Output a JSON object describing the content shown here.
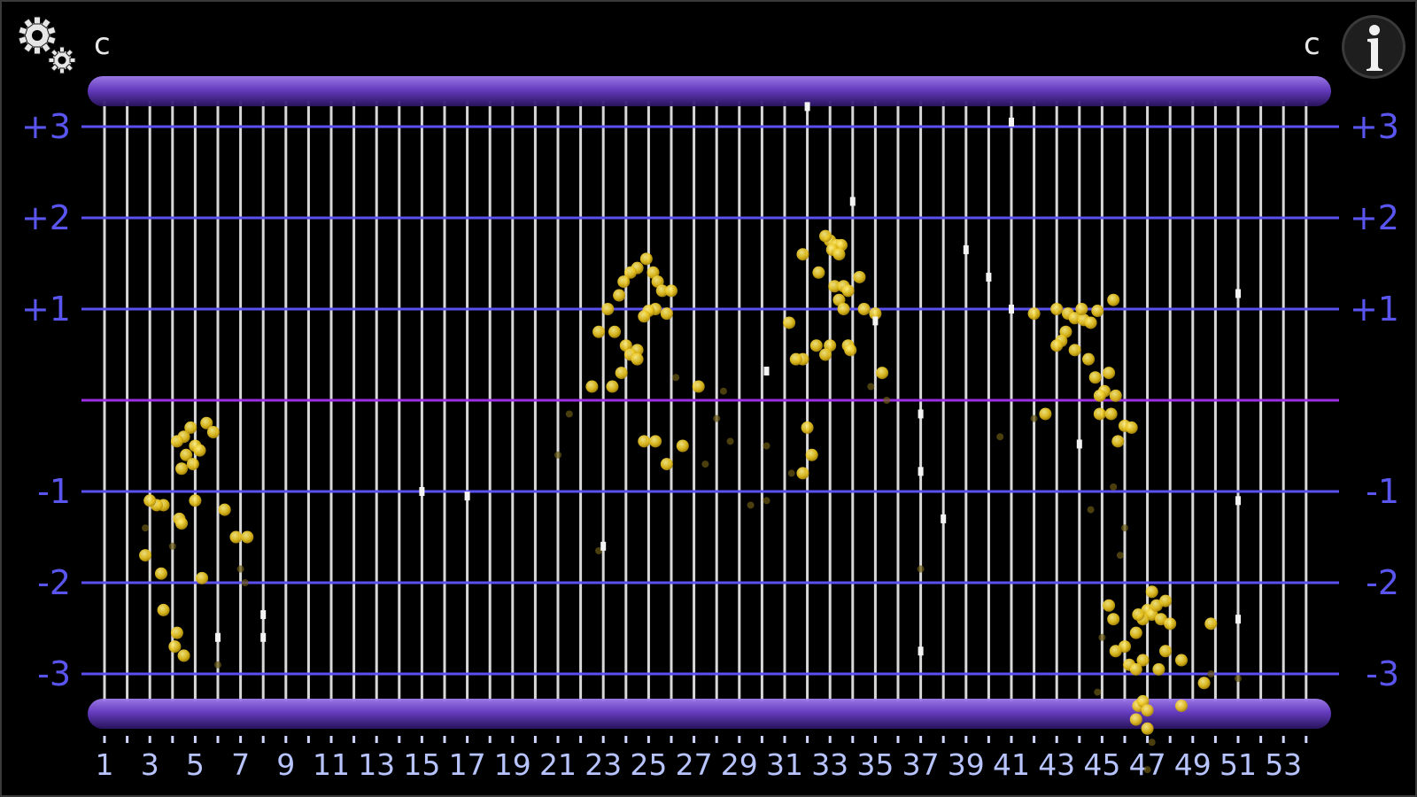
{
  "header": {
    "left_label": "c",
    "right_label": "c",
    "settings_icon": "gears-icon",
    "info_icon": "info-icon"
  },
  "colors": {
    "background": "#000000",
    "grid_vertical": "#d8d8d8",
    "grid_horizontal": "#5b4ff0",
    "baseline": "#9b30e0",
    "label": "#5a55ee",
    "x_label": "#b8c4ff",
    "dot": "#e8c21c",
    "bar": "#7a4fd6"
  },
  "chart_data": {
    "type": "scatter",
    "x_ticks": [
      "1",
      "3",
      "5",
      "7",
      "9",
      "11",
      "13",
      "15",
      "17",
      "19",
      "21",
      "23",
      "25",
      "27",
      "29",
      "31",
      "33",
      "35",
      "37",
      "39",
      "41",
      "43",
      "45",
      "47",
      "49",
      "51",
      "53"
    ],
    "xlim": [
      1,
      54
    ],
    "y_ticks": [
      "+3",
      "+2",
      "+1",
      "-1",
      "-2",
      "-3"
    ],
    "y_tick_values": [
      3,
      2,
      1,
      -1,
      -2,
      -3
    ],
    "ylim": [
      -3,
      3
    ],
    "grid": true,
    "series": [
      {
        "points": [
          [
            4.5,
            -0.4
          ],
          [
            4.8,
            -0.3
          ],
          [
            5.0,
            -0.5
          ],
          [
            4.6,
            -0.6
          ],
          [
            4.9,
            -0.7
          ],
          [
            4.4,
            -0.75
          ],
          [
            5.2,
            -0.55
          ],
          [
            4.2,
            -0.45
          ],
          [
            5.5,
            -0.25
          ],
          [
            5.8,
            -0.35
          ],
          [
            3.6,
            -1.15
          ],
          [
            3.3,
            -1.15
          ],
          [
            4.3,
            -1.3
          ],
          [
            4.4,
            -1.35
          ],
          [
            5.0,
            -1.1
          ],
          [
            6.3,
            -1.2
          ],
          [
            6.8,
            -1.5
          ],
          [
            7.3,
            -1.5
          ],
          [
            3.5,
            -1.9
          ],
          [
            5.3,
            -1.95
          ],
          [
            3.6,
            -2.3
          ],
          [
            4.2,
            -2.55
          ],
          [
            4.1,
            -2.7
          ],
          [
            4.5,
            -2.8
          ],
          [
            2.8,
            -1.7
          ],
          [
            3.0,
            -1.1
          ],
          [
            24.9,
            1.55
          ],
          [
            24.5,
            1.45
          ],
          [
            25.2,
            1.4
          ],
          [
            25.4,
            1.3
          ],
          [
            24.2,
            1.4
          ],
          [
            23.9,
            1.3
          ],
          [
            23.7,
            1.15
          ],
          [
            25.6,
            1.2
          ],
          [
            26.0,
            1.2
          ],
          [
            23.2,
            1.0
          ],
          [
            25.3,
            1.0
          ],
          [
            25.0,
            0.98
          ],
          [
            25.8,
            0.95
          ],
          [
            24.8,
            0.92
          ],
          [
            23.5,
            0.75
          ],
          [
            22.8,
            0.75
          ],
          [
            24.5,
            0.55
          ],
          [
            24.0,
            0.6
          ],
          [
            24.2,
            0.5
          ],
          [
            24.5,
            0.45
          ],
          [
            23.8,
            0.3
          ],
          [
            23.4,
            0.15
          ],
          [
            22.5,
            0.15
          ],
          [
            24.8,
            -0.45
          ],
          [
            25.3,
            -0.45
          ],
          [
            26.5,
            -0.5
          ],
          [
            25.8,
            -0.7
          ],
          [
            27.2,
            0.15
          ],
          [
            33.0,
            1.75
          ],
          [
            33.3,
            1.7
          ],
          [
            33.5,
            1.7
          ],
          [
            33.1,
            1.65
          ],
          [
            33.4,
            1.6
          ],
          [
            32.8,
            1.8
          ],
          [
            31.8,
            1.6
          ],
          [
            32.5,
            1.4
          ],
          [
            33.2,
            1.25
          ],
          [
            33.6,
            1.25
          ],
          [
            33.8,
            1.2
          ],
          [
            33.4,
            1.1
          ],
          [
            33.6,
            1.0
          ],
          [
            34.5,
            1.0
          ],
          [
            35.0,
            0.95
          ],
          [
            31.2,
            0.85
          ],
          [
            33.0,
            0.6
          ],
          [
            33.8,
            0.6
          ],
          [
            33.9,
            0.55
          ],
          [
            31.8,
            0.45
          ],
          [
            31.5,
            0.45
          ],
          [
            32.4,
            0.6
          ],
          [
            32.8,
            0.5
          ],
          [
            34.3,
            1.35
          ],
          [
            35.3,
            0.3
          ],
          [
            32.0,
            -0.3
          ],
          [
            32.2,
            -0.6
          ],
          [
            31.8,
            -0.8
          ],
          [
            43.0,
            1.0
          ],
          [
            43.5,
            0.95
          ],
          [
            43.8,
            0.9
          ],
          [
            44.2,
            0.88
          ],
          [
            44.5,
            0.85
          ],
          [
            44.1,
            1.0
          ],
          [
            43.4,
            0.75
          ],
          [
            43.2,
            0.65
          ],
          [
            43.0,
            0.6
          ],
          [
            44.8,
            0.98
          ],
          [
            45.5,
            1.1
          ],
          [
            42.0,
            0.95
          ],
          [
            44.4,
            0.45
          ],
          [
            44.7,
            0.25
          ],
          [
            45.3,
            0.3
          ],
          [
            45.1,
            0.1
          ],
          [
            44.9,
            0.05
          ],
          [
            44.9,
            -0.15
          ],
          [
            45.4,
            -0.15
          ],
          [
            46.0,
            -0.28
          ],
          [
            46.3,
            -0.3
          ],
          [
            45.7,
            -0.45
          ],
          [
            42.5,
            -0.15
          ],
          [
            43.8,
            0.55
          ],
          [
            45.6,
            0.05
          ],
          [
            47.0,
            -2.3
          ],
          [
            47.2,
            -2.35
          ],
          [
            47.4,
            -2.25
          ],
          [
            46.8,
            -2.4
          ],
          [
            46.6,
            -2.35
          ],
          [
            47.6,
            -2.4
          ],
          [
            47.8,
            -2.2
          ],
          [
            48.0,
            -2.45
          ],
          [
            46.5,
            -2.55
          ],
          [
            47.2,
            -2.1
          ],
          [
            46.0,
            -2.7
          ],
          [
            46.8,
            -2.85
          ],
          [
            47.8,
            -2.75
          ],
          [
            46.2,
            -2.9
          ],
          [
            46.5,
            -2.95
          ],
          [
            47.5,
            -2.95
          ],
          [
            48.5,
            -2.85
          ],
          [
            45.6,
            -2.75
          ],
          [
            46.6,
            -3.35
          ],
          [
            46.8,
            -3.3
          ],
          [
            47.0,
            -3.4
          ],
          [
            46.5,
            -3.5
          ],
          [
            47.0,
            -3.6
          ],
          [
            48.5,
            -3.35
          ],
          [
            49.5,
            -3.1
          ],
          [
            49.8,
            -2.45
          ],
          [
            45.5,
            -2.4
          ],
          [
            45.3,
            -2.25
          ]
        ]
      }
    ],
    "dim_points": [
      [
        4.0,
        -1.6
      ],
      [
        2.8,
        -1.4
      ],
      [
        7.0,
        -1.85
      ],
      [
        6.0,
        -2.9
      ],
      [
        7.2,
        -2.0
      ],
      [
        21.0,
        -0.6
      ],
      [
        21.5,
        -0.15
      ],
      [
        22.8,
        -1.65
      ],
      [
        26.2,
        0.25
      ],
      [
        28.0,
        -0.2
      ],
      [
        28.6,
        -0.45
      ],
      [
        28.3,
        0.1
      ],
      [
        27.5,
        -0.7
      ],
      [
        29.5,
        -1.15
      ],
      [
        30.2,
        -1.1
      ],
      [
        30.2,
        -0.5
      ],
      [
        31.3,
        -0.8
      ],
      [
        34.8,
        0.15
      ],
      [
        35.5,
        0.0
      ],
      [
        37.0,
        -1.85
      ],
      [
        40.5,
        -0.4
      ],
      [
        42.0,
        -0.2
      ],
      [
        44.5,
        -1.2
      ],
      [
        45.5,
        -0.95
      ],
      [
        45.8,
        -1.7
      ],
      [
        45.0,
        -2.6
      ],
      [
        46.0,
        -1.4
      ],
      [
        47.2,
        -3.75
      ],
      [
        47.0,
        -4.05
      ],
      [
        44.8,
        -3.2
      ],
      [
        49.8,
        -3.0
      ],
      [
        51.0,
        -3.05
      ]
    ],
    "white_points": [
      [
        32.0,
        3.22
      ],
      [
        34.0,
        2.18
      ],
      [
        30.2,
        0.32
      ],
      [
        39.0,
        1.65
      ],
      [
        40.0,
        1.35
      ],
      [
        41.0,
        3.05
      ],
      [
        35.0,
        0.87
      ],
      [
        41.0,
        1.0
      ],
      [
        44.0,
        -0.48
      ],
      [
        37.0,
        -0.78
      ],
      [
        51.0,
        1.17
      ],
      [
        51.0,
        -1.1
      ],
      [
        38.0,
        -1.3
      ],
      [
        37.0,
        -2.75
      ],
      [
        51.0,
        -2.4
      ],
      [
        6.0,
        -2.6
      ],
      [
        8.0,
        -2.6
      ],
      [
        15.0,
        -1.0
      ],
      [
        17.0,
        -1.05
      ],
      [
        8.0,
        -2.35
      ],
      [
        23.0,
        -1.6
      ],
      [
        37.0,
        -0.15
      ]
    ]
  }
}
